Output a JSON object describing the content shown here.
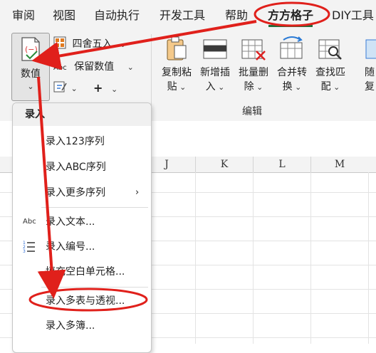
{
  "menubar": {
    "tabs": [
      {
        "label": "审阅"
      },
      {
        "label": "视图"
      },
      {
        "label": "自动执行"
      },
      {
        "label": "开发工具"
      },
      {
        "label": "帮助"
      },
      {
        "label": "方方格子"
      },
      {
        "label": "DIY工具"
      }
    ],
    "active_tab": "方方格子"
  },
  "ribbon": {
    "value_button": {
      "label": "数值",
      "icon": "number-format-icon"
    },
    "small_buttons": [
      {
        "label": "四舍五入",
        "icon": "round-icon"
      },
      {
        "label": "保留数值",
        "icon": "abc-text-icon"
      },
      {
        "label": "",
        "icon": "edit-icon"
      },
      {
        "label": "+",
        "icon": "plus-icon"
      }
    ],
    "edit_buttons": [
      {
        "label_line1": "复制粘",
        "label_line2": "贴",
        "icon": "clipboard-icon"
      },
      {
        "label_line1": "新增插",
        "label_line2": "入",
        "icon": "insert-icon"
      },
      {
        "label_line1": "批量删",
        "label_line2": "除",
        "icon": "delete-table-icon"
      },
      {
        "label_line1": "合并转",
        "label_line2": "换",
        "icon": "merge-convert-icon"
      },
      {
        "label_line1": "查找匹",
        "label_line2": "配",
        "icon": "find-match-icon"
      },
      {
        "label_line1": "随",
        "label_line2": "复",
        "icon": "random-icon"
      }
    ],
    "group_label": "编辑"
  },
  "sheet": {
    "columns": [
      "J",
      "K",
      "L",
      "M"
    ]
  },
  "dropdown": {
    "header": "录入",
    "items": [
      {
        "label": "录入123序列",
        "icon": ""
      },
      {
        "label": "录入ABC序列",
        "icon": ""
      },
      {
        "label": "录入更多序列",
        "icon": "",
        "submenu": true
      },
      {
        "label": "录入文本...",
        "icon": "Abc"
      },
      {
        "label": "录入编号...",
        "icon": "numbered-list"
      },
      {
        "label": "填充空白单元格...",
        "icon": ""
      },
      {
        "label": "录入多表与透视...",
        "icon": "",
        "highlighted": true
      },
      {
        "label": "录入多簿...",
        "icon": ""
      }
    ]
  },
  "colors": {
    "annotation_red": "#e0201b",
    "accent_green": "#1e6e3b"
  }
}
